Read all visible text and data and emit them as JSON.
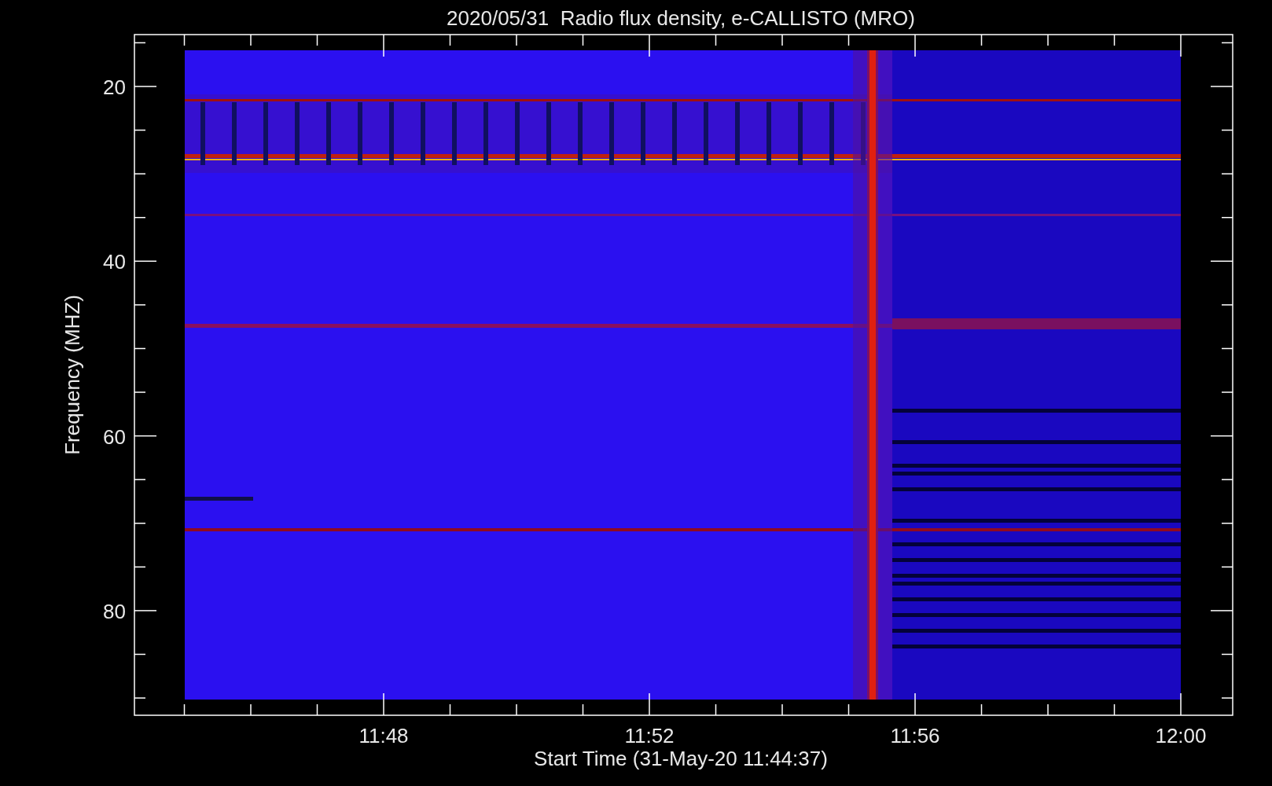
{
  "title": "2020/05/31  Radio flux density, e-CALLISTO (MRO)",
  "y_axis": {
    "label": "Frequency (MHZ)",
    "ticks": [
      "20",
      "40",
      "60",
      "80"
    ]
  },
  "x_axis": {
    "label": "Start Time (31-May-20 11:44:37)",
    "ticks": [
      "11:48",
      "11:52",
      "11:56",
      "12:00"
    ]
  }
}
